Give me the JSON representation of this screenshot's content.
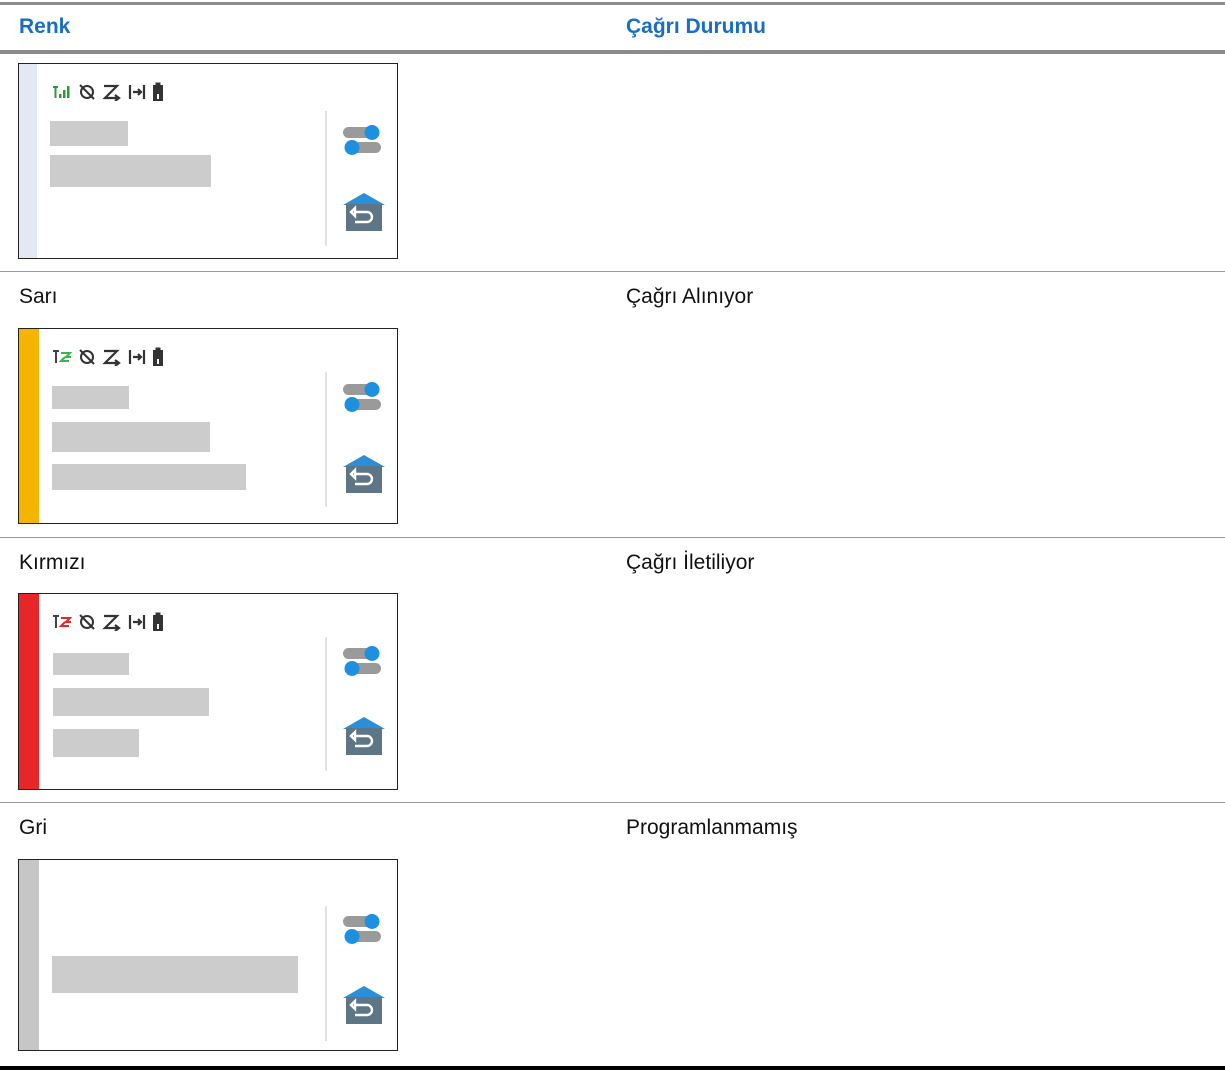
{
  "table": {
    "headers": {
      "color": "Renk",
      "status": "Çağrı Durumu"
    },
    "rows": [
      {
        "color": "",
        "status": "",
        "stripe_color": "#e3e9f2",
        "has_status_icons": true,
        "signal_type": "bars",
        "signal_color": "#2e9a3b",
        "bar_count": 2
      },
      {
        "color": "Sarı",
        "status": "Çağrı Alınıyor",
        "stripe_color": "#f5b400",
        "has_status_icons": true,
        "signal_type": "receive",
        "signal_color": "#39b54a",
        "bar_count": 3
      },
      {
        "color": "Kırmızı",
        "status": "Çağrı İletiliyor",
        "stripe_color": "#e8262a",
        "has_status_icons": true,
        "signal_type": "transmit",
        "signal_color": "#e8262a",
        "bar_count": 3
      },
      {
        "color": "Gri",
        "status": "Programlanmamış",
        "stripe_color": "#c6c6c6",
        "has_status_icons": false,
        "bar_count": 1
      }
    ]
  },
  "icons": {
    "status": [
      "signal-icon",
      "gps-off-icon",
      "scan-icon",
      "talkaround-icon",
      "battery-icon"
    ],
    "side": [
      "toggle-icon",
      "home-back-icon"
    ]
  },
  "colors": {
    "header_text": "#1a6ec2",
    "toggle_blue": "#1e90e0",
    "home_blue": "#2a8fd6",
    "home_slate": "#5e7585"
  }
}
